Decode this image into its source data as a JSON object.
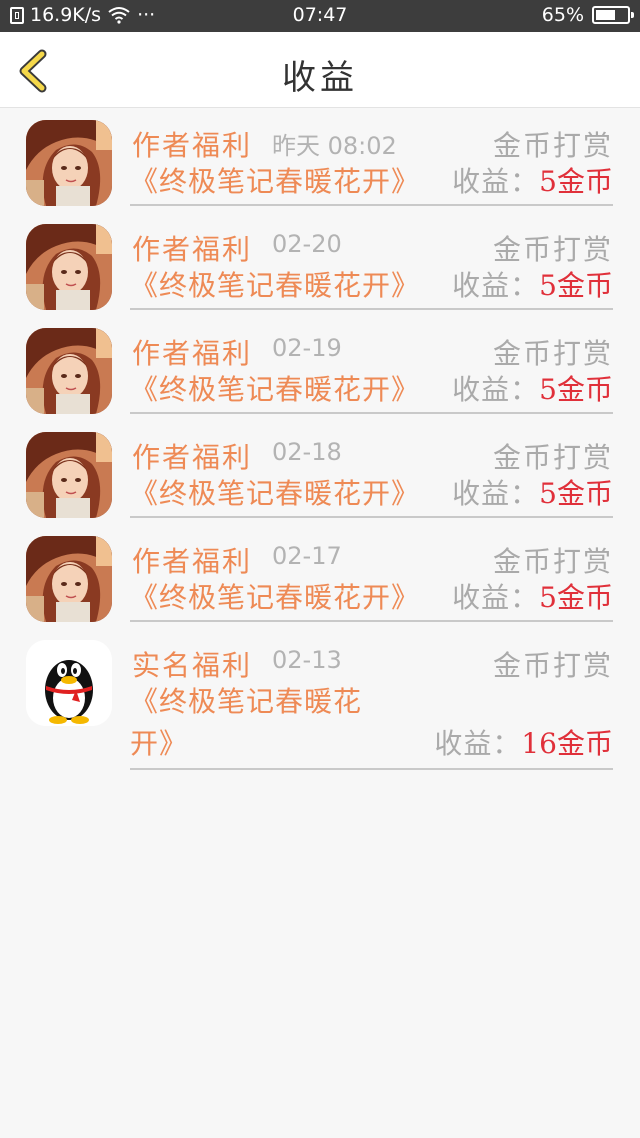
{
  "status_bar": {
    "speed": "16.9K/s",
    "dots": "···",
    "time": "07:47",
    "battery": "65%",
    "battery_level": 0.65
  },
  "header": {
    "title": "收益"
  },
  "items": [
    {
      "avatar": "anime-avatar",
      "label": "作者福利",
      "date": "昨天 08:02",
      "type": "金币打赏",
      "book": "《终极笔记春暖花开》",
      "earn_label": "收益：",
      "earn_value": "5金币"
    },
    {
      "avatar": "anime-avatar",
      "label": "作者福利",
      "date": "02-20",
      "type": "金币打赏",
      "book": "《终极笔记春暖花开》",
      "earn_label": "收益：",
      "earn_value": "5金币"
    },
    {
      "avatar": "anime-avatar",
      "label": "作者福利",
      "date": "02-19",
      "type": "金币打赏",
      "book": "《终极笔记春暖花开》",
      "earn_label": "收益：",
      "earn_value": "5金币"
    },
    {
      "avatar": "anime-avatar",
      "label": "作者福利",
      "date": "02-18",
      "type": "金币打赏",
      "book": "《终极笔记春暖花开》",
      "earn_label": "收益：",
      "earn_value": "5金币"
    },
    {
      "avatar": "anime-avatar",
      "label": "作者福利",
      "date": "02-17",
      "type": "金币打赏",
      "book": "《终极笔记春暖花开》",
      "earn_label": "收益：",
      "earn_value": "5金币"
    },
    {
      "avatar": "qq-penguin-avatar",
      "label": "实名福利",
      "date": "02-13",
      "type": "金币打赏",
      "book_line1": "《终极笔记春暖花",
      "book_line2": "开》",
      "earn_label": "收益：",
      "earn_value": "16金币"
    }
  ],
  "colors": {
    "accent_orange": "#ee8a55",
    "earn_red": "#e0303a",
    "muted_gray": "#aaaaaa",
    "back_arrow_yellow": "#f5d84a"
  }
}
